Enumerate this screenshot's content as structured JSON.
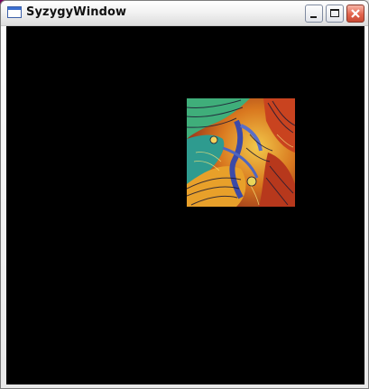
{
  "window": {
    "title": "SyzygyWindow",
    "icon": "app-window-icon",
    "controls": {
      "minimize": "minimize-icon",
      "maximize": "maximize-icon",
      "close": "close-icon"
    }
  },
  "canvas": {
    "background_color": "#000000",
    "texture_image": "psychedelic-swirl-texture"
  }
}
